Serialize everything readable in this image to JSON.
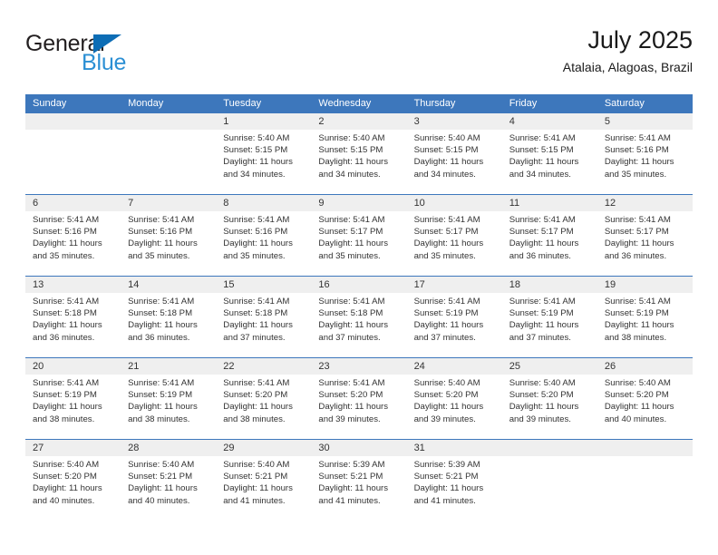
{
  "brand": {
    "name_part1": "General",
    "name_part2": "Blue",
    "flag_icon": "blue-triangle-flag-icon"
  },
  "header": {
    "title": "July 2025",
    "subtitle": "Atalaia, Alagoas, Brazil"
  },
  "colors": {
    "header_blue": "#3d77bc",
    "brand_dark": "#231f20",
    "brand_blue": "#2b8fd4",
    "flag_blue": "#0d6db5",
    "daynum_band": "#efefef",
    "text": "#333333"
  },
  "weekdays": [
    "Sunday",
    "Monday",
    "Tuesday",
    "Wednesday",
    "Thursday",
    "Friday",
    "Saturday"
  ],
  "labels": {
    "sunrise": "Sunrise:",
    "sunset": "Sunset:",
    "daylight": "Daylight:"
  },
  "weeks": [
    [
      {
        "day": "",
        "empty": true
      },
      {
        "day": "",
        "empty": true
      },
      {
        "day": "1",
        "sunrise": "Sunrise: 5:40 AM",
        "sunset": "Sunset: 5:15 PM",
        "daylight": "Daylight: 11 hours and 34 minutes."
      },
      {
        "day": "2",
        "sunrise": "Sunrise: 5:40 AM",
        "sunset": "Sunset: 5:15 PM",
        "daylight": "Daylight: 11 hours and 34 minutes."
      },
      {
        "day": "3",
        "sunrise": "Sunrise: 5:40 AM",
        "sunset": "Sunset: 5:15 PM",
        "daylight": "Daylight: 11 hours and 34 minutes."
      },
      {
        "day": "4",
        "sunrise": "Sunrise: 5:41 AM",
        "sunset": "Sunset: 5:15 PM",
        "daylight": "Daylight: 11 hours and 34 minutes."
      },
      {
        "day": "5",
        "sunrise": "Sunrise: 5:41 AM",
        "sunset": "Sunset: 5:16 PM",
        "daylight": "Daylight: 11 hours and 35 minutes."
      }
    ],
    [
      {
        "day": "6",
        "sunrise": "Sunrise: 5:41 AM",
        "sunset": "Sunset: 5:16 PM",
        "daylight": "Daylight: 11 hours and 35 minutes."
      },
      {
        "day": "7",
        "sunrise": "Sunrise: 5:41 AM",
        "sunset": "Sunset: 5:16 PM",
        "daylight": "Daylight: 11 hours and 35 minutes."
      },
      {
        "day": "8",
        "sunrise": "Sunrise: 5:41 AM",
        "sunset": "Sunset: 5:16 PM",
        "daylight": "Daylight: 11 hours and 35 minutes."
      },
      {
        "day": "9",
        "sunrise": "Sunrise: 5:41 AM",
        "sunset": "Sunset: 5:17 PM",
        "daylight": "Daylight: 11 hours and 35 minutes."
      },
      {
        "day": "10",
        "sunrise": "Sunrise: 5:41 AM",
        "sunset": "Sunset: 5:17 PM",
        "daylight": "Daylight: 11 hours and 35 minutes."
      },
      {
        "day": "11",
        "sunrise": "Sunrise: 5:41 AM",
        "sunset": "Sunset: 5:17 PM",
        "daylight": "Daylight: 11 hours and 36 minutes."
      },
      {
        "day": "12",
        "sunrise": "Sunrise: 5:41 AM",
        "sunset": "Sunset: 5:17 PM",
        "daylight": "Daylight: 11 hours and 36 minutes."
      }
    ],
    [
      {
        "day": "13",
        "sunrise": "Sunrise: 5:41 AM",
        "sunset": "Sunset: 5:18 PM",
        "daylight": "Daylight: 11 hours and 36 minutes."
      },
      {
        "day": "14",
        "sunrise": "Sunrise: 5:41 AM",
        "sunset": "Sunset: 5:18 PM",
        "daylight": "Daylight: 11 hours and 36 minutes."
      },
      {
        "day": "15",
        "sunrise": "Sunrise: 5:41 AM",
        "sunset": "Sunset: 5:18 PM",
        "daylight": "Daylight: 11 hours and 37 minutes."
      },
      {
        "day": "16",
        "sunrise": "Sunrise: 5:41 AM",
        "sunset": "Sunset: 5:18 PM",
        "daylight": "Daylight: 11 hours and 37 minutes."
      },
      {
        "day": "17",
        "sunrise": "Sunrise: 5:41 AM",
        "sunset": "Sunset: 5:19 PM",
        "daylight": "Daylight: 11 hours and 37 minutes."
      },
      {
        "day": "18",
        "sunrise": "Sunrise: 5:41 AM",
        "sunset": "Sunset: 5:19 PM",
        "daylight": "Daylight: 11 hours and 37 minutes."
      },
      {
        "day": "19",
        "sunrise": "Sunrise: 5:41 AM",
        "sunset": "Sunset: 5:19 PM",
        "daylight": "Daylight: 11 hours and 38 minutes."
      }
    ],
    [
      {
        "day": "20",
        "sunrise": "Sunrise: 5:41 AM",
        "sunset": "Sunset: 5:19 PM",
        "daylight": "Daylight: 11 hours and 38 minutes."
      },
      {
        "day": "21",
        "sunrise": "Sunrise: 5:41 AM",
        "sunset": "Sunset: 5:19 PM",
        "daylight": "Daylight: 11 hours and 38 minutes."
      },
      {
        "day": "22",
        "sunrise": "Sunrise: 5:41 AM",
        "sunset": "Sunset: 5:20 PM",
        "daylight": "Daylight: 11 hours and 38 minutes."
      },
      {
        "day": "23",
        "sunrise": "Sunrise: 5:41 AM",
        "sunset": "Sunset: 5:20 PM",
        "daylight": "Daylight: 11 hours and 39 minutes."
      },
      {
        "day": "24",
        "sunrise": "Sunrise: 5:40 AM",
        "sunset": "Sunset: 5:20 PM",
        "daylight": "Daylight: 11 hours and 39 minutes."
      },
      {
        "day": "25",
        "sunrise": "Sunrise: 5:40 AM",
        "sunset": "Sunset: 5:20 PM",
        "daylight": "Daylight: 11 hours and 39 minutes."
      },
      {
        "day": "26",
        "sunrise": "Sunrise: 5:40 AM",
        "sunset": "Sunset: 5:20 PM",
        "daylight": "Daylight: 11 hours and 40 minutes."
      }
    ],
    [
      {
        "day": "27",
        "sunrise": "Sunrise: 5:40 AM",
        "sunset": "Sunset: 5:20 PM",
        "daylight": "Daylight: 11 hours and 40 minutes."
      },
      {
        "day": "28",
        "sunrise": "Sunrise: 5:40 AM",
        "sunset": "Sunset: 5:21 PM",
        "daylight": "Daylight: 11 hours and 40 minutes."
      },
      {
        "day": "29",
        "sunrise": "Sunrise: 5:40 AM",
        "sunset": "Sunset: 5:21 PM",
        "daylight": "Daylight: 11 hours and 41 minutes."
      },
      {
        "day": "30",
        "sunrise": "Sunrise: 5:39 AM",
        "sunset": "Sunset: 5:21 PM",
        "daylight": "Daylight: 11 hours and 41 minutes."
      },
      {
        "day": "31",
        "sunrise": "Sunrise: 5:39 AM",
        "sunset": "Sunset: 5:21 PM",
        "daylight": "Daylight: 11 hours and 41 minutes."
      },
      {
        "day": "",
        "empty": true
      },
      {
        "day": "",
        "empty": true
      }
    ]
  ]
}
